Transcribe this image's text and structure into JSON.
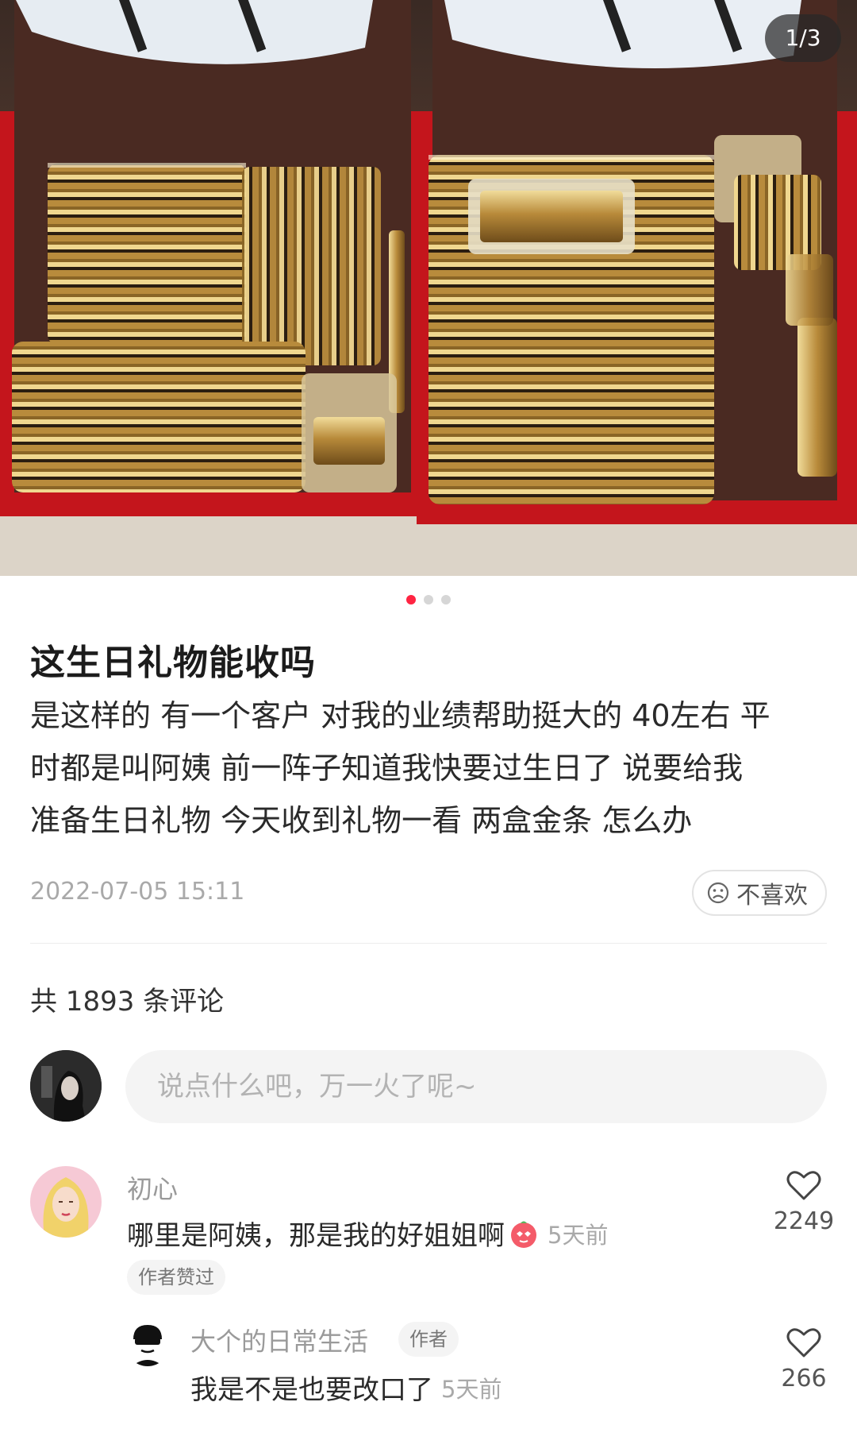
{
  "gallery": {
    "counter": "1/3",
    "dots": [
      true,
      false,
      false
    ]
  },
  "post": {
    "title": "这生日礼物能收吗",
    "body_lines": [
      "是这样的 有一个客户 对我的业绩帮助挺大的 40左右 平",
      "时都是叫阿姨 前一阵子知道我快要过生日了 说要给我",
      "准备生日礼物 今天收到礼物一看 两盒金条 怎么办"
    ],
    "date": "2022-07-05 15:11",
    "dislike_label": "不喜欢"
  },
  "comments_section": {
    "count_label": "共 1893 条评论",
    "input_placeholder": "说点什么吧，万一火了呢~"
  },
  "comments": [
    {
      "author": "初心",
      "text": "哪里是阿姨，那是我的好姐姐啊",
      "time": "5天前",
      "badge": "作者赞过",
      "likes": "2249"
    },
    {
      "author": "大个的日常生活",
      "author_tag": "作者",
      "text": "我是不是也要改口了",
      "time": "5天前",
      "likes": "266"
    }
  ],
  "colors": {
    "accent": "#ff2442",
    "box_red": "#c4151c",
    "gold": "#c9a24a"
  }
}
